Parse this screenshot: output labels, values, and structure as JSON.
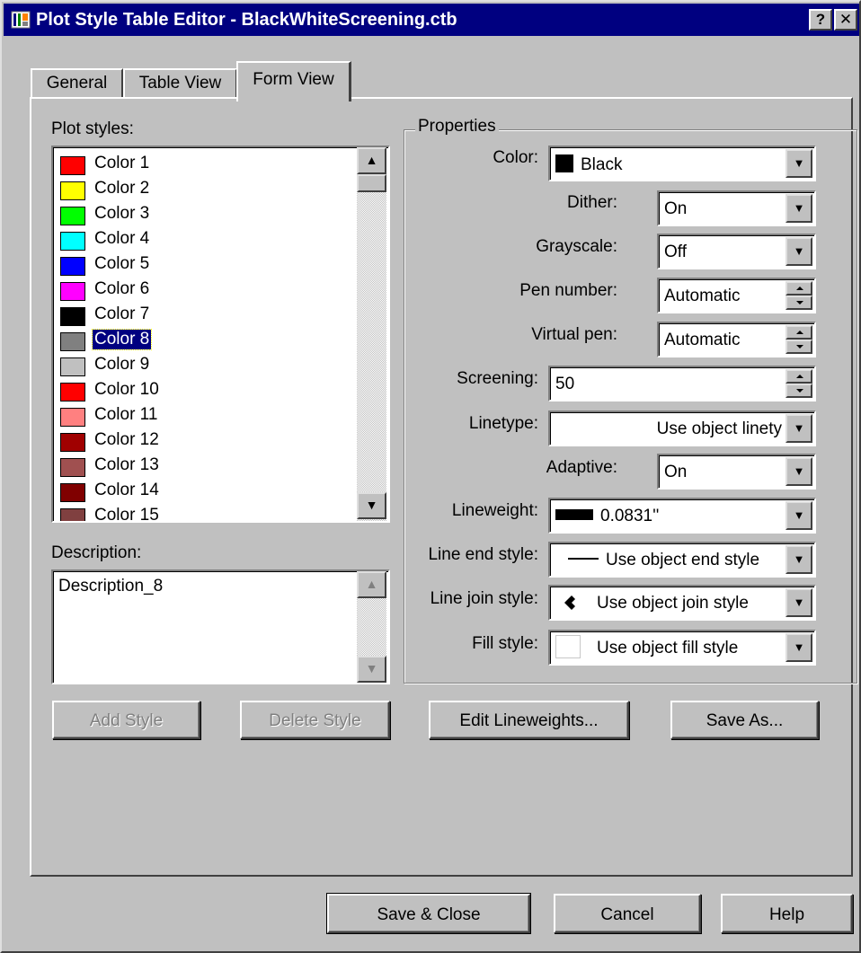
{
  "window": {
    "title": "Plot Style Table Editor - BlackWhiteScreening.ctb",
    "help_glyph": "?",
    "close_glyph": "✕"
  },
  "tabs": [
    {
      "label": "General",
      "active": false
    },
    {
      "label": "Table View",
      "active": false
    },
    {
      "label": "Form View",
      "active": true
    }
  ],
  "plot_styles": {
    "label": "Plot styles:",
    "selected_index": 7,
    "items": [
      {
        "label": "Color 1",
        "color": "#ff0000"
      },
      {
        "label": "Color 2",
        "color": "#ffff00"
      },
      {
        "label": "Color 3",
        "color": "#00ff00"
      },
      {
        "label": "Color 4",
        "color": "#00ffff"
      },
      {
        "label": "Color 5",
        "color": "#0000ff"
      },
      {
        "label": "Color 6",
        "color": "#ff00ff"
      },
      {
        "label": "Color 7",
        "color": "#000000"
      },
      {
        "label": "Color 8",
        "color": "#808080"
      },
      {
        "label": "Color 9",
        "color": "#c0c0c0"
      },
      {
        "label": "Color 10",
        "color": "#ff0000"
      },
      {
        "label": "Color 11",
        "color": "#ff8080"
      },
      {
        "label": "Color 12",
        "color": "#a00000"
      },
      {
        "label": "Color 13",
        "color": "#a05050"
      },
      {
        "label": "Color 14",
        "color": "#800000"
      },
      {
        "label": "Color 15",
        "color": "#804040"
      }
    ]
  },
  "description": {
    "label": "Description:",
    "value": "Description_8"
  },
  "properties": {
    "title": "Properties",
    "color": {
      "label": "Color:",
      "value": "Black"
    },
    "dither": {
      "label": "Dither:",
      "value": "On"
    },
    "grayscale": {
      "label": "Grayscale:",
      "value": "Off"
    },
    "pen_number": {
      "label": "Pen number:",
      "value": "Automatic"
    },
    "virtual_pen": {
      "label": "Virtual pen:",
      "value": "Automatic"
    },
    "screening": {
      "label": "Screening:",
      "value": "50"
    },
    "linetype": {
      "label": "Linetype:",
      "value": "Use object linety"
    },
    "adaptive": {
      "label": "Adaptive:",
      "value": "On"
    },
    "lineweight": {
      "label": "Lineweight:",
      "value": "0.0831''"
    },
    "line_end_style": {
      "label": "Line end style:",
      "value": "Use object end style"
    },
    "line_join_style": {
      "label": "Line join style:",
      "value": "Use object join style"
    },
    "fill_style": {
      "label": "Fill style:",
      "value": "Use object fill style"
    }
  },
  "buttons": {
    "add_style": "Add Style",
    "delete_style": "Delete Style",
    "edit_lineweights": "Edit Lineweights...",
    "save_as": "Save As...",
    "save_close": "Save & Close",
    "cancel": "Cancel",
    "help": "Help"
  },
  "colors": {
    "title_bar": "#000080",
    "dialog_face": "#c0c0c0",
    "selection": "#000080"
  }
}
